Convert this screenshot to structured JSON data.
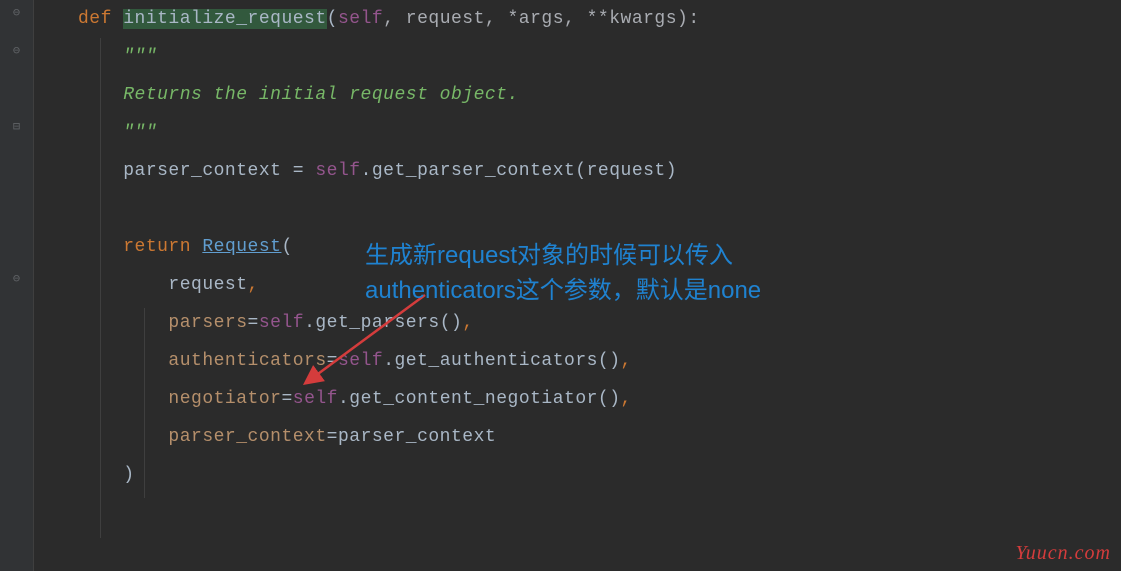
{
  "code": {
    "def": "def ",
    "fn_name": "initialize_request",
    "sig": "(",
    "self": "self",
    "sig_rest": ", request, *args, **kwargs):",
    "docq1": "\"\"\"",
    "doc_body": "Returns the initial request object.",
    "docq2": "\"\"\"",
    "pctx_lhs": "parser_context = ",
    "pctx_self": "self",
    "pctx_call": ".get_parser_context(request)",
    "ret": "return ",
    "request_cls": "Request",
    "openp": "(",
    "arg1": "request",
    "comma": ",",
    "p_parsers": "parsers",
    "eq": "=",
    "p_self": "self",
    "get_parsers": ".get_parsers()",
    "p_auth": "authenticators",
    "get_auth": ".get_authenticators()",
    "p_neg": "negotiator",
    "get_neg": ".get_content_negotiator()",
    "p_pctx": "parser_context",
    "p_pctx_val": "parser_context",
    "closep": ")"
  },
  "annotation": {
    "line1": "生成新request对象的时候可以传入",
    "line2": "authenticators这个参数，默认是none"
  },
  "watermark": "Yuucn.com"
}
